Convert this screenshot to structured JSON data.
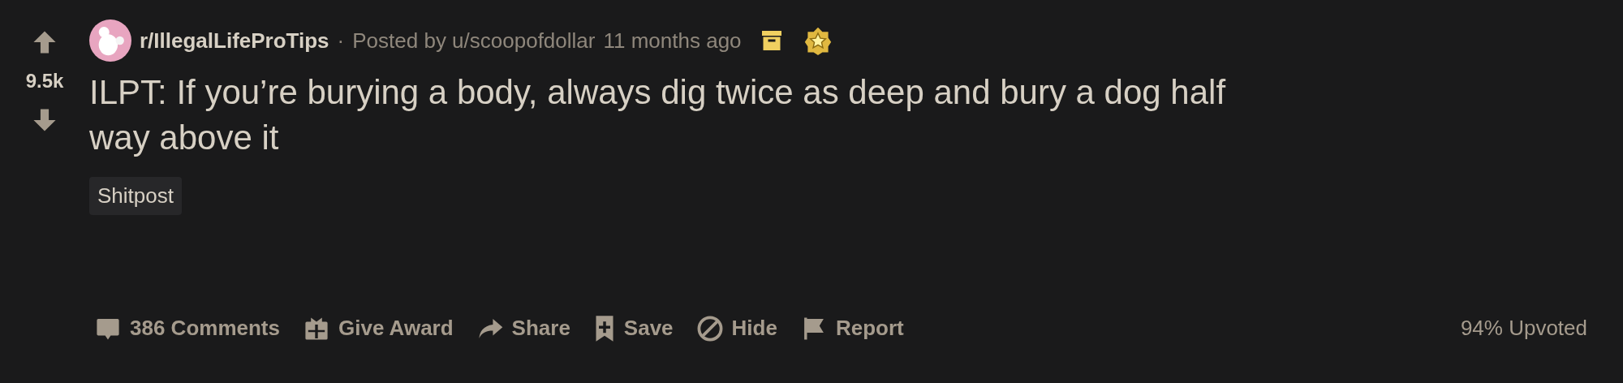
{
  "vote": {
    "score": "9.5k"
  },
  "header": {
    "subreddit": "r/IllegalLifeProTips",
    "separator": "·",
    "posted_by": "Posted by u/scoopofdollar",
    "time": "11 months ago"
  },
  "title": "ILPT: If you’re burying a body, always dig twice as deep and bury a dog half way above it",
  "flair": "Shitpost",
  "actions": [
    {
      "kind": "comments",
      "label": "386 Comments"
    },
    {
      "kind": "award",
      "label": "Give Award"
    },
    {
      "kind": "share",
      "label": "Share"
    },
    {
      "kind": "save",
      "label": "Save"
    },
    {
      "kind": "hide",
      "label": "Hide"
    },
    {
      "kind": "report",
      "label": "Report"
    }
  ],
  "upvote_ratio": "94% Upvoted"
}
